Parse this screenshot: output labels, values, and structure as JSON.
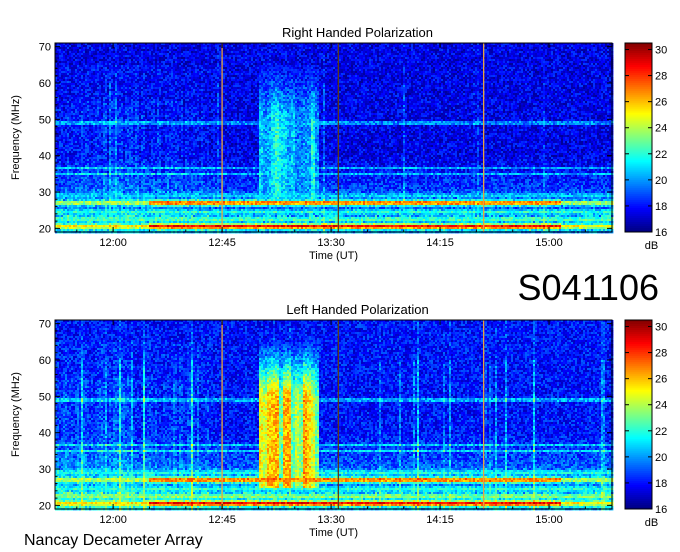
{
  "station_id": "S041106",
  "instrument": "Nancay Decameter Array",
  "chart_data": [
    {
      "type": "heatmap",
      "title": "Right Handed Polarization",
      "xlabel": "Time (UT)",
      "ylabel": "Frequency (MHz)",
      "x_tick_labels": [
        "12:00",
        "12:45",
        "13:30",
        "14:15",
        "15:00"
      ],
      "x_ticks_minutes": [
        720,
        765,
        810,
        855,
        900
      ],
      "xlim_minutes": [
        696,
        926
      ],
      "y_ticks": [
        20,
        30,
        40,
        50,
        60,
        70
      ],
      "ylim": [
        19,
        71
      ],
      "colorbar": {
        "label": "dB",
        "range": [
          16,
          30.5
        ],
        "ticks": [
          16,
          18,
          20,
          22,
          24,
          26,
          28,
          30
        ]
      },
      "features": {
        "background_db": 17.5,
        "low_freq_bands": [
          {
            "freq_mhz": 20.5,
            "db": 30
          },
          {
            "freq_mhz": 22.5,
            "db": 23
          },
          {
            "freq_mhz": 24.5,
            "db": 22
          },
          {
            "freq_mhz": 27,
            "db": 29
          },
          {
            "freq_mhz": 29,
            "db": 21
          }
        ],
        "emission_burst": {
          "start": "13:00",
          "end": "13:25",
          "freq_range_mhz": [
            28,
            65
          ],
          "peak_db": 22
        },
        "vertical_lines": [
          "12:45",
          "13:33",
          "14:33"
        ]
      }
    },
    {
      "type": "heatmap",
      "title": "Left Handed Polarization",
      "xlabel": "Time (UT)",
      "ylabel": "Frequency (MHz)",
      "x_tick_labels": [
        "12:00",
        "12:45",
        "13:30",
        "14:15",
        "15:00"
      ],
      "x_ticks_minutes": [
        720,
        765,
        810,
        855,
        900
      ],
      "xlim_minutes": [
        696,
        926
      ],
      "y_ticks": [
        20,
        30,
        40,
        50,
        60,
        70
      ],
      "ylim": [
        19,
        71
      ],
      "colorbar": {
        "label": "dB",
        "range": [
          16,
          30.5
        ],
        "ticks": [
          16,
          18,
          20,
          22,
          24,
          26,
          28,
          30
        ]
      },
      "features": {
        "background_db": 18,
        "low_freq_bands": [
          {
            "freq_mhz": 20.5,
            "db": 30
          },
          {
            "freq_mhz": 22.5,
            "db": 24
          },
          {
            "freq_mhz": 24.5,
            "db": 22
          },
          {
            "freq_mhz": 27,
            "db": 29
          },
          {
            "freq_mhz": 29,
            "db": 22
          }
        ],
        "emission_burst": {
          "start": "13:00",
          "end": "13:25",
          "freq_range_mhz": [
            25,
            65
          ],
          "peak_db": 27
        },
        "vertical_lines": [
          "12:45",
          "13:33",
          "14:33"
        ]
      }
    }
  ]
}
